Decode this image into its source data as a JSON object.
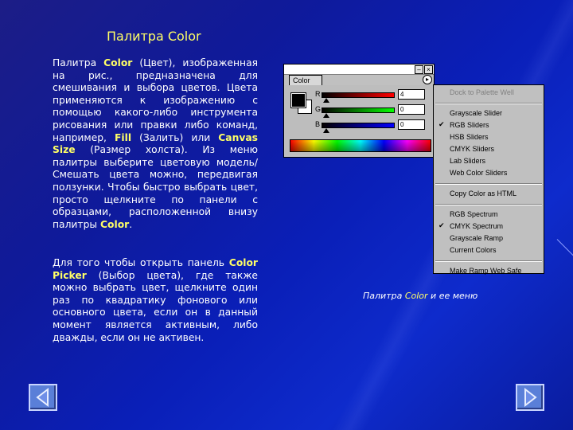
{
  "title": "Палитра Color",
  "paragraph1": [
    {
      "t": "Палитра "
    },
    {
      "t": "Color",
      "b": true
    },
    {
      "t": " (Цвет), изображенная на рис., предназначена для смешивания и выбора цветов. Цвета применяются к изображению с помощью какого-либо инструмента рисования или правки либо команд, например, "
    },
    {
      "t": "Fill",
      "b": true
    },
    {
      "t": " (Залить) или "
    },
    {
      "t": "Canvas Size",
      "b": true
    },
    {
      "t": " (Размер холста). Из меню палитры выберите цветовую модель/Смешать цвета можно, передвигая ползунки. Чтобы быстро выбрать цвет, просто щелкните по панели с образцами, расположенной внизу палитры "
    },
    {
      "t": "Color",
      "b": true
    },
    {
      "t": "."
    }
  ],
  "paragraph2": [
    {
      "t": "Для того чтобы открыть панель "
    },
    {
      "t": "Color Picker",
      "b": true
    },
    {
      "t": " (Выбор цвета), где также можно выбрать цвет, щелкните один раз по квадратику фонового или основного цвета, если он в данный момент является активным, либо дважды, если он не активен."
    }
  ],
  "caption": [
    {
      "t": "Палитра "
    },
    {
      "t": "Color",
      "b": true
    },
    {
      "t": " и ее меню"
    }
  ],
  "palette": {
    "tab_label": "Color",
    "close_glyph": "×",
    "minimize_glyph": "–",
    "menu_glyph": "▸",
    "rows": [
      {
        "label": "R",
        "value": "4"
      },
      {
        "label": "G",
        "value": "0"
      },
      {
        "label": "B",
        "value": "0"
      }
    ]
  },
  "menu": {
    "items": [
      {
        "label": "Dock to Palette Well",
        "disabled": true,
        "checked": false
      },
      {
        "sep": true
      },
      {
        "label": "Grayscale Slider",
        "checked": false
      },
      {
        "label": "RGB Sliders",
        "checked": true
      },
      {
        "label": "HSB Sliders",
        "checked": false
      },
      {
        "label": "CMYK Sliders",
        "checked": false
      },
      {
        "label": "Lab Sliders",
        "checked": false
      },
      {
        "label": "Web Color Sliders",
        "checked": false
      },
      {
        "sep": true
      },
      {
        "label": "Copy Color as HTML",
        "checked": false
      },
      {
        "sep": true
      },
      {
        "label": "RGB Spectrum",
        "checked": false
      },
      {
        "label": "CMYK Spectrum",
        "checked": true
      },
      {
        "label": "Grayscale Ramp",
        "checked": false
      },
      {
        "label": "Current Colors",
        "checked": false
      },
      {
        "sep": true
      },
      {
        "label": "Make Ramp Web Safe",
        "checked": false
      }
    ],
    "check_glyph": "✔"
  },
  "colors": {
    "title": "#ffff66",
    "slider_r": "#d40000",
    "slider_g": "#00a000",
    "slider_b": "#0000d0",
    "nav_button": "#5a7fd8"
  },
  "icons": {
    "prev": "triangle-left-icon",
    "next": "triangle-right-icon"
  }
}
